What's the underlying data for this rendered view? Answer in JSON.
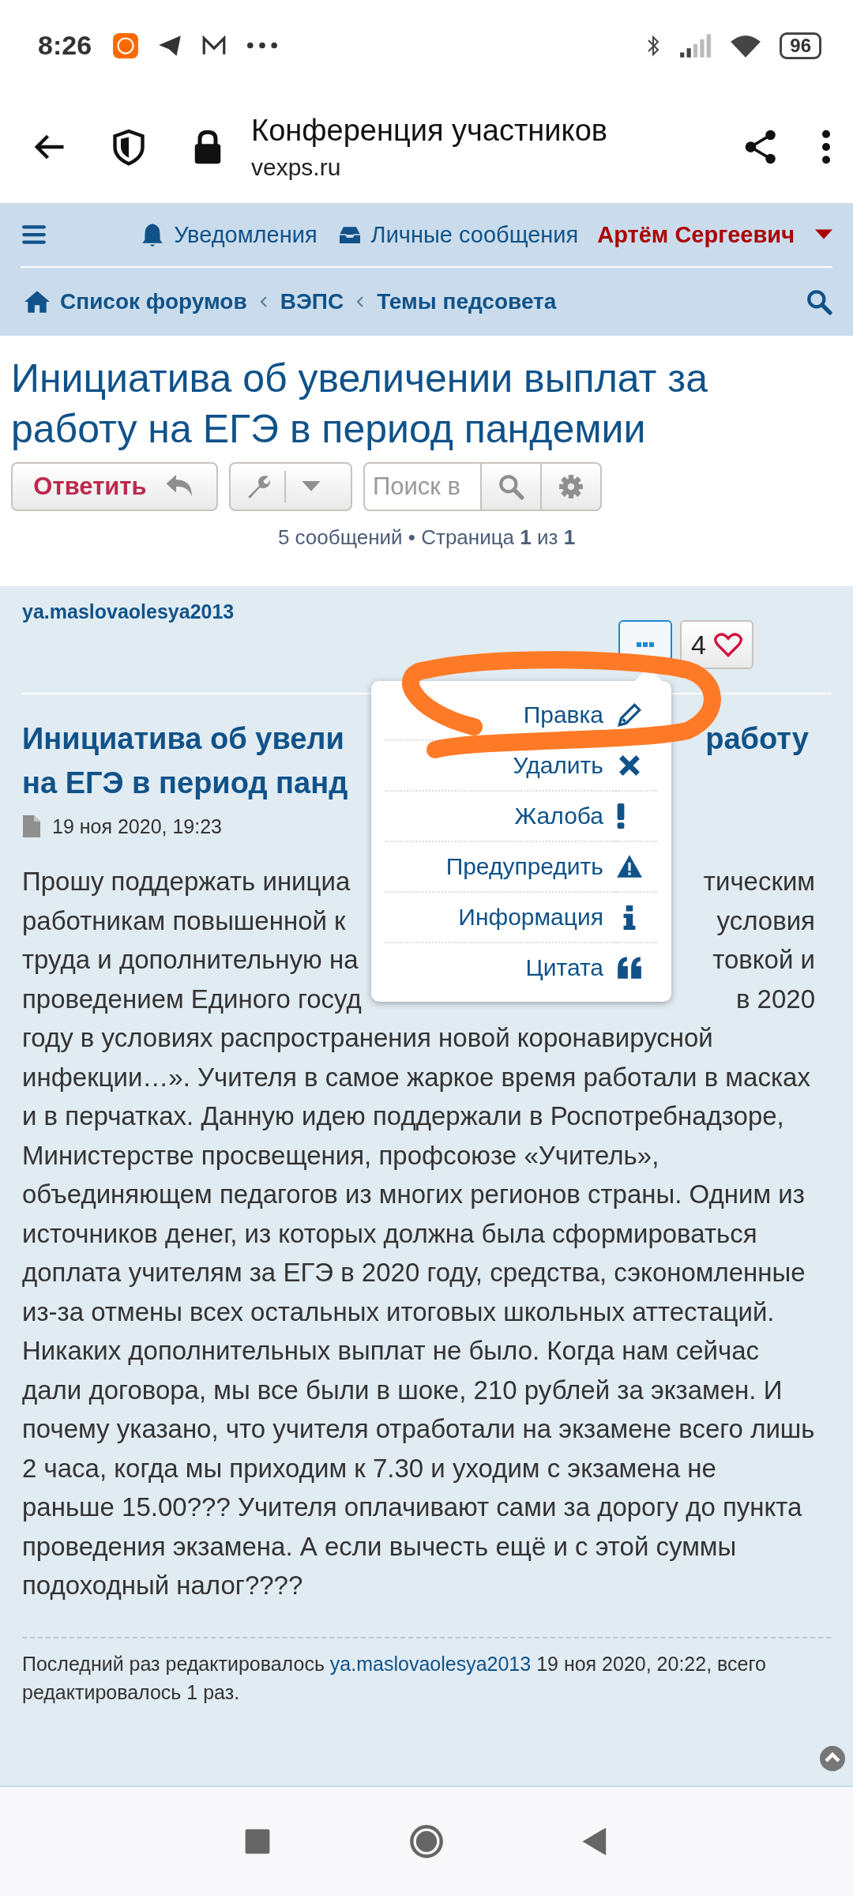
{
  "status_bar": {
    "time": "8:26",
    "battery": "96"
  },
  "browser": {
    "title": "Конференция участников",
    "url": "vexps.ru"
  },
  "nav": {
    "notifications": "Уведомления",
    "messages": "Личные сообщения",
    "user": "Артём Сергеевич"
  },
  "breadcrumbs": [
    "Список форумов",
    "ВЭПС",
    "Темы педсовета"
  ],
  "topic": {
    "title": "Инициатива об увеличении выплат за работу на ЕГЭ в период пандемии",
    "reply_button": "Ответить",
    "search_placeholder": "Поиск в",
    "pagination": "5 сообщений • Страница **1** из **1**"
  },
  "post": {
    "author": "ya.maslovaolesya2013",
    "menu_open": true,
    "likes": "4",
    "heading_lines": [
      {
        "left": "Инициатива об увели",
        "right": "работу"
      },
      {
        "left": "на ЕГЭ в период панд"
      }
    ],
    "date": "19 ноя 2020, 19:23",
    "covered_lines": [
      {
        "left": "Прошу поддержать инициа",
        "right": "тическим"
      },
      {
        "left": "работникам повышенной к",
        "right": "условия"
      },
      {
        "left": "труда и дополнительную на",
        "right": "товкой и"
      },
      {
        "left": "проведением Единого госуд",
        "right": "в 2020"
      }
    ],
    "text": "году в условиях распространения новой коронавирусной инфекции…». Учителя в самое жаркое время работали в масках и в перчатках. Данную идею поддержали в Роспотребнадзоре, Министерстве просвещения, профсоюзе «Учитель», объединяющем педагогов из многих регионов страны. Одним из источников денег, из которых должна была сформироваться доплата учителям за ЕГЭ в 2020 году, средства, сэкономленные из-за отмены всех остальных итоговых школьных аттестаций. Никаких дополнительных выплат не было. Когда нам сейчас дали договора, мы все были в шоке, 210 рублей за экзамен. И почему указано, что учителя отработали на экзамене всего лишь 2 часа, когда мы приходим к 7.30 и уходим с экзамена не раньше 15.00??? Учителя оплачивают сами за дорогу до пункта проведения экзамена. А если вычесть ещё и с этой суммы подоходный налог????",
    "edit_note": {
      "before": "Последний раз редактировалось ",
      "link": "ya.maslovaolesya2013",
      "after": " 19 ноя 2020, 20:22, всего редактировалось 1 раз."
    }
  },
  "menu": [
    {
      "label": "Правка",
      "kind": "edit"
    },
    {
      "label": "Удалить",
      "kind": "delete"
    },
    {
      "label": "Жалоба",
      "kind": "report"
    },
    {
      "label": "Предупредить",
      "kind": "warn"
    },
    {
      "label": "Информация",
      "kind": "info"
    },
    {
      "label": "Цитата",
      "kind": "quote"
    }
  ]
}
